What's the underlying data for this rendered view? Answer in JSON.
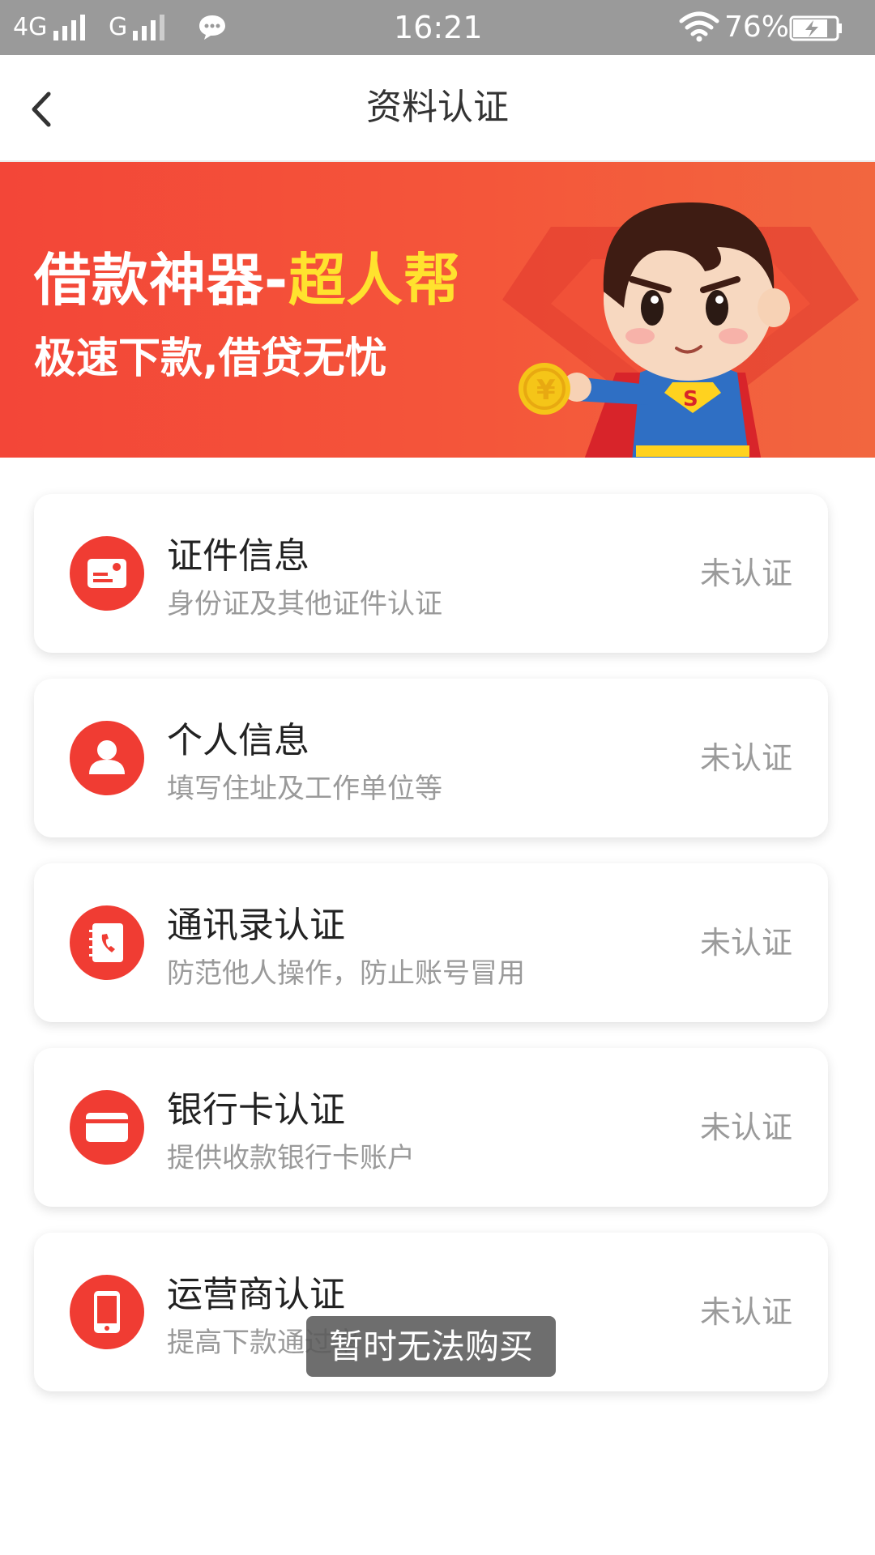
{
  "status_bar": {
    "network_1": "4G",
    "network_2": "G",
    "time": "16:21",
    "battery": "76%",
    "icons": [
      "signal-icon",
      "chat-icon",
      "wifi-icon",
      "battery-charging-icon"
    ]
  },
  "header": {
    "title": "资料认证",
    "back_icon": "chevron-left-icon"
  },
  "banner": {
    "title_white": "借款神器-",
    "title_yellow": "超人帮",
    "subtitle": "极速下款,借贷无忧",
    "colors": {
      "background": "#f34638",
      "highlight": "#ffe22e"
    }
  },
  "items": [
    {
      "title": "证件信息",
      "subtitle": "身份证及其他证件认证",
      "status": "未认证",
      "icon": "id-card-icon"
    },
    {
      "title": "个人信息",
      "subtitle": "填写住址及工作单位等",
      "status": "未认证",
      "icon": "person-icon"
    },
    {
      "title": "通讯录认证",
      "subtitle": "防范他人操作，防止账号冒用",
      "status": "未认证",
      "icon": "contacts-book-icon"
    },
    {
      "title": "银行卡认证",
      "subtitle": "提供收款银行卡账户",
      "status": "未认证",
      "icon": "bank-card-icon"
    },
    {
      "title": "运营商认证",
      "subtitle": "提高下款通过率",
      "status": "未认证",
      "icon": "phone-icon"
    }
  ],
  "toast": {
    "text": "暂时无法购买"
  },
  "colors": {
    "accent": "#f03c33",
    "muted_text": "#9a9a9a",
    "status_bar": "#9a9a9a"
  }
}
